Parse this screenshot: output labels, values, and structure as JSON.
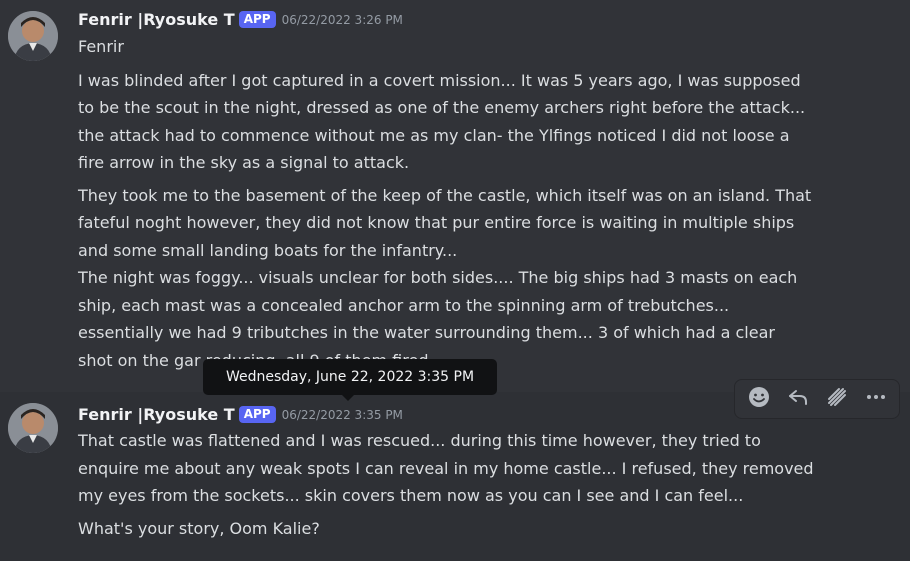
{
  "messages": [
    {
      "author": "Fenrir |Ryosuke T",
      "badge": "APP",
      "timestamp": "06/22/2022 3:26 PM",
      "lines": [
        "Fenrir",
        "I was blinded after I got captured in a covert mission... It was 5 years ago, I was supposed",
        "to be the scout in the night, dressed as one of the enemy archers right before the attack...",
        "the attack had to commence without me as my clan- the Ylfings noticed I did not loose a",
        "fire arrow in the sky as a signal to attack.",
        "They took me to the basement of the keep of the castle, which itself was on an island. That",
        "fateful noght however, they did not know that pur entire force is waiting in multiple ships",
        "and some small landing boats for the infantry...",
        "The night was foggy... visuals unclear for both sides.... The big ships had 3 masts on each",
        "ship, each mast was a concealed anchor arm to the spinning arm of trebutches...",
        "essentially we had 9 tributches in the water surrounding them... 3 of which had a clear",
        "shot on the gar                                                 reducing, all 9 of them fired..."
      ]
    },
    {
      "author": "Fenrir |Ryosuke T",
      "badge": "APP",
      "timestamp": "06/22/2022 3:35 PM",
      "lines": [
        "That castle was flattened and I was rescued... during this time however, they tried to",
        "enquire me about any weak spots I can reveal in my home castle... I refused, they removed",
        "my eyes from the sockets... skin covers them now as you can I see and I can feel...",
        "What's your story, Oom Kalie?"
      ]
    }
  ],
  "tooltip": "Wednesday, June 22, 2022 3:35 PM",
  "toolbar_icons": [
    "add-reaction-icon",
    "reply-icon",
    "create-thread-icon",
    "more-icon"
  ],
  "colors": {
    "background": "#313338",
    "hover_background": "#2e3035",
    "badge": "#5865f2",
    "tooltip": "#111214",
    "text": "#dbdee1",
    "timestamp": "#949ba4"
  }
}
